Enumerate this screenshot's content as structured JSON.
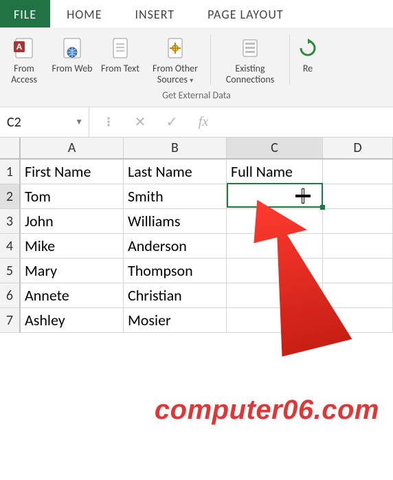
{
  "tabs": {
    "file": "FILE",
    "home": "HOME",
    "insert": "INSERT",
    "page_layout": "PAGE LAYOUT"
  },
  "ribbon": {
    "group_caption": "Get External Data",
    "from_access": "From Access",
    "from_web": "From Web",
    "from_text": "From Text",
    "from_other": "From Other Sources",
    "existing_conn": "Existing Connections",
    "refresh": "Re"
  },
  "namebox": {
    "value": "C2"
  },
  "fx": {
    "label": "fx"
  },
  "columns": {
    "A": "A",
    "B": "B",
    "C": "C",
    "D": "D"
  },
  "row_nums": [
    "1",
    "2",
    "3",
    "4",
    "5",
    "6",
    "7"
  ],
  "cells": {
    "A1": "First Name",
    "B1": "Last Name",
    "C1": "Full Name",
    "A2": "Tom",
    "B2": "Smith",
    "C2": "",
    "A3": "John",
    "B3": "Williams",
    "C3": "",
    "A4": "Mike",
    "B4": "Anderson",
    "C4": "",
    "A5": "Mary",
    "B5": "Thompson",
    "C5": "",
    "A6": "Annete",
    "B6": "Christian",
    "C6": "",
    "A7": "Ashley",
    "B7": "Mosier",
    "C7": ""
  },
  "selection": {
    "ref": "C2"
  },
  "watermark": "computer06.com"
}
